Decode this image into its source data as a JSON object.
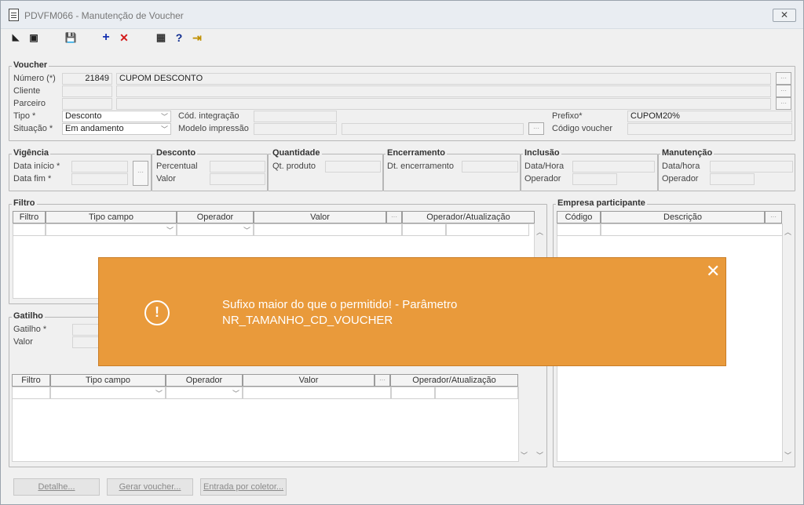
{
  "window": {
    "title": "PDVFM066 - Manutenção de Voucher",
    "close_label": "✕"
  },
  "toolbar": [
    {
      "name": "back-icon",
      "glyph": "◣"
    },
    {
      "name": "copy-icon",
      "glyph": "▣"
    },
    {
      "name": "save-icon",
      "glyph": "💾"
    },
    {
      "name": "add-icon",
      "glyph": "+"
    },
    {
      "name": "delete-icon",
      "glyph": "✕"
    },
    {
      "name": "calendar-icon",
      "glyph": "▦"
    },
    {
      "name": "help-icon",
      "glyph": "?"
    },
    {
      "name": "exit-icon",
      "glyph": "⇥"
    }
  ],
  "voucher": {
    "title": "Voucher",
    "numero_label": "Número (*)",
    "numero_value": "21849",
    "numero_desc": "CUPOM DESCONTO",
    "cliente_label": "Cliente",
    "parceiro_label": "Parceiro",
    "tipo_label": "Tipo *",
    "tipo_value": "Desconto",
    "situacao_label": "Situação *",
    "situacao_value": "Em andamento",
    "cod_integracao_label": "Cód. integração",
    "modelo_impressao_label": "Modelo impressão",
    "prefixo_label": "Prefixo*",
    "prefixo_value": "CUPOM20%",
    "codigo_voucher_label": "Código voucher"
  },
  "vigencia": {
    "title": "Vigência",
    "inicio_label": "Data início *",
    "fim_label": "Data fim *"
  },
  "desconto": {
    "title": "Desconto",
    "percentual_label": "Percentual",
    "valor_label": "Valor"
  },
  "quantidade": {
    "title": "Quantidade",
    "produto_label": "Qt. produto"
  },
  "encerramento": {
    "title": "Encerramento",
    "dt_label": "Dt. encerramento"
  },
  "inclusao": {
    "title": "Inclusão",
    "datahora_label": "Data/Hora",
    "operador_label": "Operador"
  },
  "manutencao": {
    "title": "Manutenção",
    "datahora_label": "Data/hora",
    "operador_label": "Operador"
  },
  "filtro": {
    "title": "Filtro",
    "columns": [
      "Filtro",
      "Tipo campo",
      "Operador",
      "Valor",
      "Operador/Atualização"
    ]
  },
  "empresa": {
    "title": "Empresa participante",
    "columns": [
      "Código",
      "Descrição"
    ]
  },
  "gatilho": {
    "title": "Gatilho",
    "gatilho_label": "Gatilho *",
    "valor_label": "Valor"
  },
  "filtro2": {
    "columns": [
      "Filtro",
      "Tipo campo",
      "Operador",
      "Valor",
      "Operador/Atualização"
    ]
  },
  "buttons": {
    "detalhe": "Detalhe...",
    "gerar": "Gerar voucher...",
    "entrada": "Entrada por coletor..."
  },
  "toast": {
    "line1": "Sufixo maior do que o permitido! - Parâmetro",
    "line2": "NR_TAMANHO_CD_VOUCHER",
    "color": "#e99a3b"
  }
}
